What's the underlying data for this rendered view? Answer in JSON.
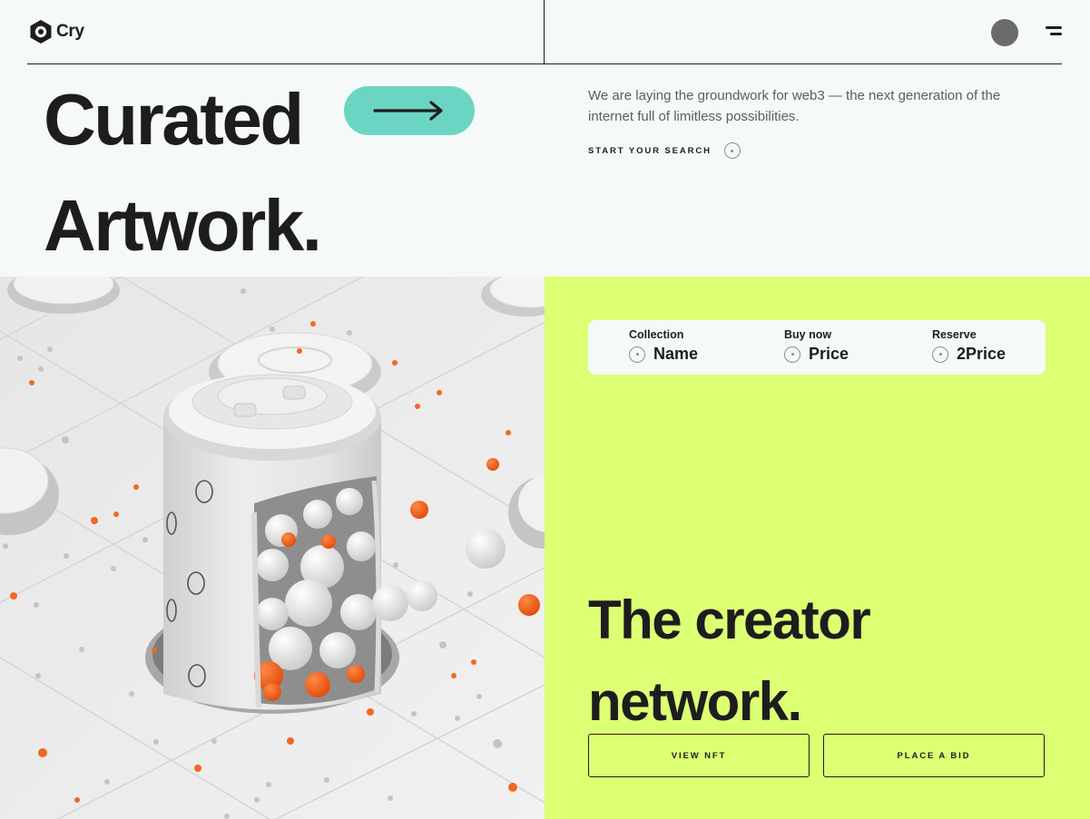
{
  "header": {
    "logo_text": "Cry",
    "menu_icon": "menu-icon"
  },
  "hero": {
    "title_line1": "Curated",
    "title_line2": "Artwork.",
    "arrow_icon": "arrow-right-icon",
    "description": "We are laying the groundwork for web3 — the next generation of the internet full of limitless possibilities.",
    "search_label": "START YOUR SEARCH"
  },
  "artwork": {
    "icon": "3d-render-image"
  },
  "filters": [
    {
      "label": "Collection",
      "value": "Name"
    },
    {
      "label": "Buy now",
      "value": "Price"
    },
    {
      "label": "Reserve",
      "value": "2Price"
    }
  ],
  "creator": {
    "title_line1": "The creator",
    "title_line2": "network.",
    "view_button": "VIEW NFT",
    "bid_button": "PLACE A BID"
  },
  "colors": {
    "accent_teal": "#6bd5c3",
    "accent_lime": "#dcff73",
    "background": "#f5f9f8",
    "text": "#1d1d1f"
  }
}
